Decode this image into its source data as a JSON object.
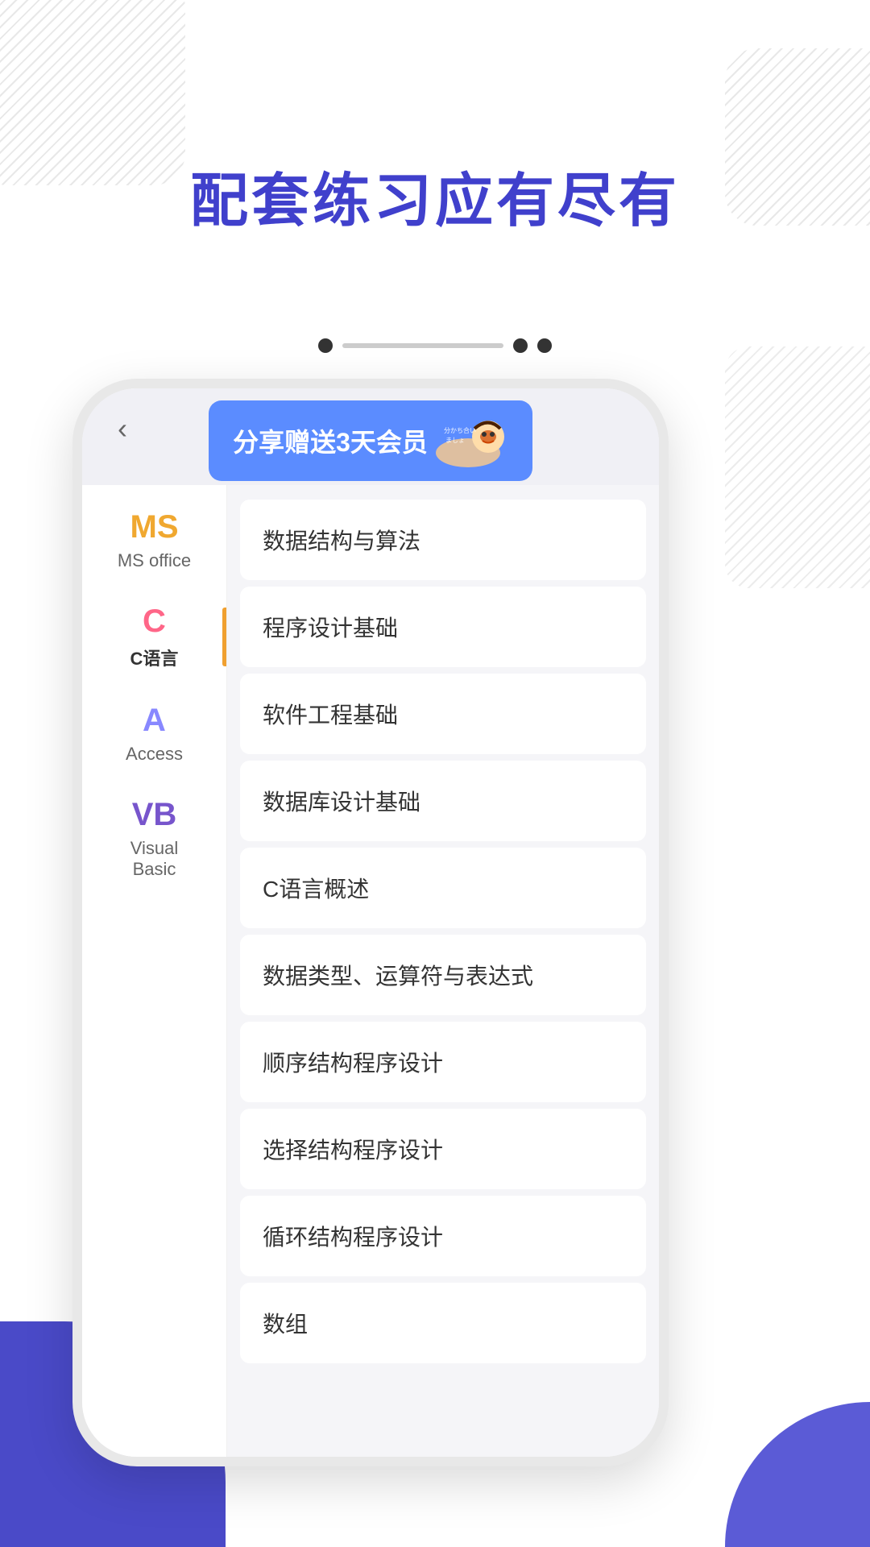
{
  "page": {
    "background_color": "#ffffff",
    "title": "配套练习应有尽有"
  },
  "dots": {
    "items": [
      "filled",
      "line",
      "filled",
      "filled"
    ]
  },
  "banner": {
    "text": "分享赠送3天会员",
    "mascot_label": "分かち合いましょ"
  },
  "sidebar": {
    "items": [
      {
        "id": "ms-office",
        "icon": "MS",
        "label": "MS office",
        "color_class": "ms-color",
        "active": false
      },
      {
        "id": "c-lang",
        "icon": "C",
        "label": "C语言",
        "color_class": "c-color",
        "active": true
      },
      {
        "id": "access",
        "icon": "A",
        "label": "Access",
        "color_class": "a-color",
        "active": false
      },
      {
        "id": "vb",
        "icon": "VB",
        "label": "Visual Basic",
        "color_class": "vb-color",
        "active": false
      }
    ]
  },
  "chapters": {
    "items": [
      {
        "id": 1,
        "title": "数据结构与算法"
      },
      {
        "id": 2,
        "title": "程序设计基础"
      },
      {
        "id": 3,
        "title": "软件工程基础"
      },
      {
        "id": 4,
        "title": "数据库设计基础"
      },
      {
        "id": 5,
        "title": "C语言概述"
      },
      {
        "id": 6,
        "title": "数据类型、运算符与表达式"
      },
      {
        "id": 7,
        "title": "顺序结构程序设计"
      },
      {
        "id": 8,
        "title": "选择结构程序设计"
      },
      {
        "id": 9,
        "title": "循环结构程序设计"
      },
      {
        "id": 10,
        "title": "数组"
      }
    ]
  },
  "nav": {
    "back_label": "‹"
  }
}
